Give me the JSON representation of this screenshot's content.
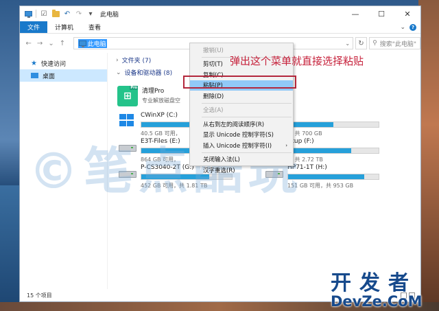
{
  "window": {
    "title": "此电脑",
    "controls": {
      "minimize": "—",
      "maximize": "☐",
      "close": "✕"
    }
  },
  "ribbon": {
    "tabs": [
      "文件",
      "计算机",
      "查看"
    ],
    "expand_symbol": "⌄",
    "help_symbol": "?"
  },
  "address": {
    "back": "←",
    "forward": "→",
    "recent": "⌄",
    "up": "↑",
    "path": "此电脑",
    "search_placeholder": "搜索\"此电脑\""
  },
  "nav": {
    "items": [
      {
        "label": "快速访问",
        "icon": "star-icon"
      },
      {
        "label": "桌面",
        "icon": "desktop-icon"
      }
    ]
  },
  "groups": {
    "folders": "文件夹 (7)",
    "devices": "设备和驱动器 (8)"
  },
  "app": {
    "name": "清理Pro",
    "desc": "专业解放磁盘空",
    "badge": "Pro",
    "glyph": "⊞"
  },
  "drives": [
    {
      "name": "CWinXP (C:)",
      "free_text": "40.5 GB 可用，",
      "fill": 0.55,
      "icon": "windows-drive-icon"
    },
    {
      "name": "",
      "free_text": "… 共 700 GB",
      "fill": 0.5,
      "icon": ""
    },
    {
      "name": "E3T-Files (E:)",
      "free_text": "864 GB 可用，",
      "fill": 0.7,
      "icon": "hdd-icon"
    },
    {
      "name": "ckup (F:)",
      "free_text": "… 共 2.72 TB",
      "fill": 0.7,
      "icon": ""
    },
    {
      "name": "P-CS3040-2T (G:)",
      "free_text": "452 GB 可用，共 1.81 TB",
      "fill": 0.75,
      "icon": "hdd-icon"
    },
    {
      "name": "HP71-1T (H:)",
      "free_text": "151 GB 可用，共 953 GB",
      "fill": 0.84,
      "icon": "hdd-icon"
    }
  ],
  "status": {
    "count": "15 个项目"
  },
  "menu": {
    "items": [
      {
        "label": "撤销(U)",
        "disabled": true
      },
      {
        "label": "剪切(T)",
        "disabled": false
      },
      {
        "label": "复制(C)",
        "disabled": false
      },
      {
        "label": "粘贴(P)",
        "disabled": false,
        "highlighted": true
      },
      {
        "label": "删除(D)",
        "disabled": false
      },
      {
        "label": "全选(A)",
        "disabled": true
      },
      {
        "label": "从右到左的阅读顺序(R)",
        "disabled": false
      },
      {
        "label": "显示 Unicode 控制字符(S)",
        "disabled": false
      },
      {
        "label": "插入 Unicode 控制字符(I)",
        "disabled": false,
        "submenu": true
      },
      {
        "label": "关闭输入法(L)",
        "disabled": false
      },
      {
        "label": "汉字重选(R)",
        "disabled": false
      }
    ],
    "submenu_arrow": "›"
  },
  "annotation": "弹出这个菜单就直接选择粘贴",
  "watermark": "©笔点酷玩",
  "site_logo": {
    "cn": "开发者",
    "en": "DevZe.CoM"
  },
  "colors": {
    "accent": "#1979ca",
    "annotation": "#c61f39",
    "highlight": "#91c9f7",
    "bar": "#26a0da"
  }
}
